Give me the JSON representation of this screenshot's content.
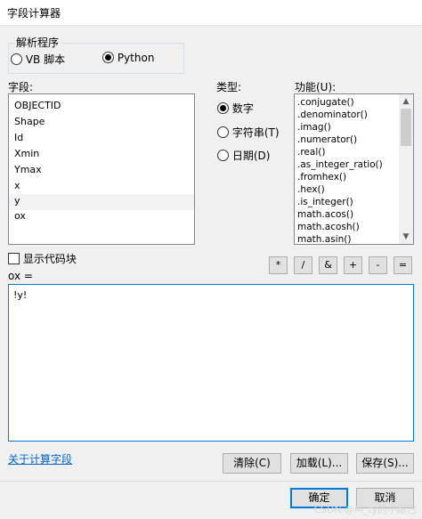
{
  "window": {
    "title": "字段计算器"
  },
  "parser": {
    "group_label": "解析程序",
    "options": [
      {
        "label": "VB 脚本",
        "checked": false
      },
      {
        "label": "Python",
        "checked": true
      }
    ]
  },
  "fields": {
    "label": "字段:",
    "items": [
      "OBJECTID",
      "Shape",
      "Id",
      "Xmin",
      "Ymax",
      "x",
      "y",
      "ox"
    ]
  },
  "type": {
    "label": "类型:",
    "options": [
      {
        "label": "数字",
        "checked": true
      },
      {
        "label": "字符串(T)",
        "checked": false
      },
      {
        "label": "日期(D)",
        "checked": false
      }
    ]
  },
  "functions": {
    "label": "功能(U):",
    "items": [
      ".conjugate()",
      ".denominator()",
      ".imag()",
      ".numerator()",
      ".real()",
      ".as_integer_ratio()",
      ".fromhex()",
      ".hex()",
      ".is_integer()",
      "math.acos()",
      "math.acosh()",
      "math.asin()"
    ]
  },
  "show_codeblock": {
    "label": "显示代码块",
    "checked": false
  },
  "operators": [
    "*",
    "/",
    "&",
    "+",
    "-",
    "="
  ],
  "expression": {
    "label": "ox =",
    "value": "!y!"
  },
  "link": {
    "label": "关于计算字段"
  },
  "buttons": {
    "clear": "清除(C)",
    "load": "加载(L)...",
    "save": "保存(S)...",
    "ok": "确定",
    "cancel": "取消"
  },
  "watermark": "CSDN @M_ty的小跟巴"
}
